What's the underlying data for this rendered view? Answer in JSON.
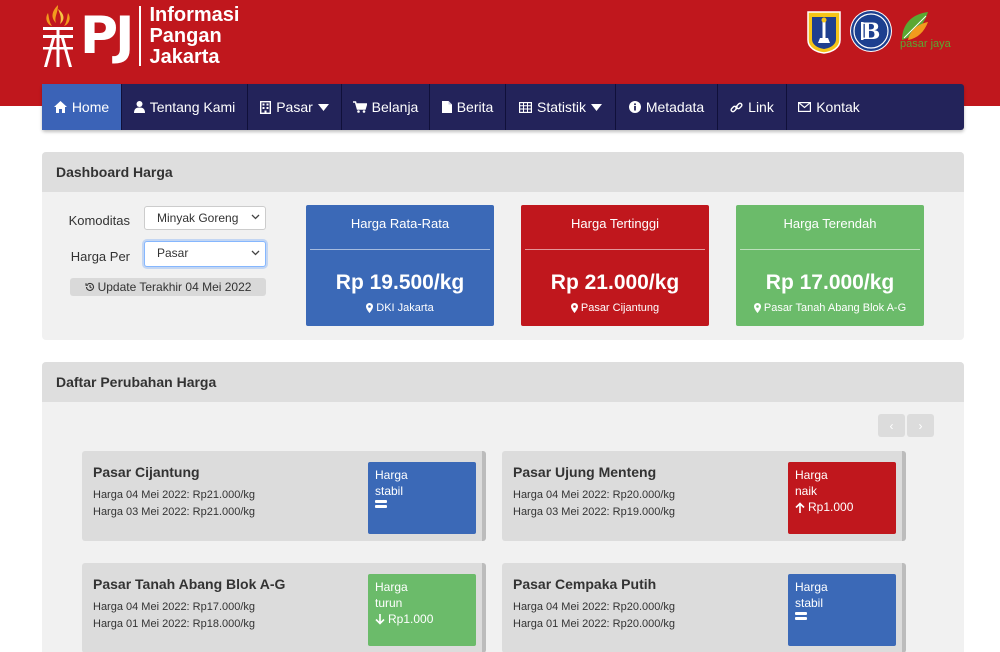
{
  "header": {
    "logo_initials": "PJ",
    "logo_line1": "Informasi",
    "logo_line2": "Pangan",
    "logo_line3": "Jakarta",
    "partner3_text": "pasar jaya"
  },
  "nav": [
    {
      "label": "Home",
      "icon": "home-icon"
    },
    {
      "label": "Tentang Kami",
      "icon": "user-icon"
    },
    {
      "label": "Pasar",
      "icon": "building-icon"
    },
    {
      "label": "Belanja",
      "icon": "cart-icon"
    },
    {
      "label": "Berita",
      "icon": "file-icon"
    },
    {
      "label": "Statistik",
      "icon": "table-icon"
    },
    {
      "label": "Metadata",
      "icon": "info-icon"
    },
    {
      "label": "Link",
      "icon": "link-icon"
    },
    {
      "label": "Kontak",
      "icon": "envelope-icon"
    }
  ],
  "dashboard": {
    "title": "Dashboard Harga",
    "komoditas_label": "Komoditas",
    "komoditas_value": "Minyak Goreng",
    "harga_per_label": "Harga Per",
    "harga_per_value": "Pasar",
    "update_text": "Update Terakhir 04 Mei 2022",
    "stats": [
      {
        "title": "Harga Rata-Rata",
        "value": "Rp 19.500/kg",
        "location": "DKI Jakarta",
        "color": "#3b69b7"
      },
      {
        "title": "Harga Tertinggi",
        "value": "Rp 21.000/kg",
        "location": "Pasar Cijantung",
        "color": "#c0171d"
      },
      {
        "title": "Harga Terendah",
        "value": "Rp 17.000/kg",
        "location": "Pasar Tanah Abang Blok A-G",
        "color": "#6bbb6a"
      }
    ]
  },
  "changes": {
    "title": "Daftar Perubahan Harga",
    "prev_label": "‹",
    "next_label": "›",
    "cards": [
      {
        "market": "Pasar Cijantung",
        "line1": "Harga 04 Mei 2022: Rp21.000/kg",
        "line2": "Harga 03 Mei 2022: Rp21.000/kg",
        "status1": "Harga",
        "status2": "stabil",
        "amount": "",
        "trend": "stable"
      },
      {
        "market": "Pasar Ujung Menteng",
        "line1": "Harga 04 Mei 2022: Rp20.000/kg",
        "line2": "Harga 03 Mei 2022: Rp19.000/kg",
        "status1": "Harga",
        "status2": "naik",
        "amount": "Rp1.000",
        "trend": "up"
      },
      {
        "market": "Pasar Tanah Abang Blok A-G",
        "line1": "Harga 04 Mei 2022: Rp17.000/kg",
        "line2": "Harga 01 Mei 2022: Rp18.000/kg",
        "status1": "Harga",
        "status2": "turun",
        "amount": "Rp1.000",
        "trend": "down"
      },
      {
        "market": "Pasar Cempaka Putih",
        "line1": "Harga 04 Mei 2022: Rp20.000/kg",
        "line2": "Harga 01 Mei 2022: Rp20.000/kg",
        "status1": "Harga",
        "status2": "stabil",
        "amount": "",
        "trend": "stable"
      }
    ]
  }
}
